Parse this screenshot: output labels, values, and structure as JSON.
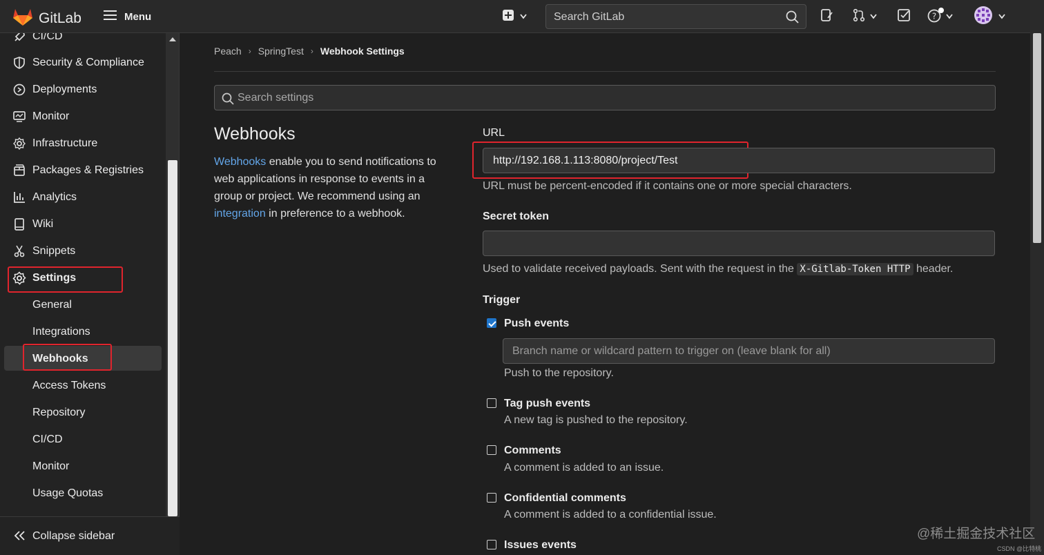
{
  "topbar": {
    "app_name": "GitLab",
    "menu_label": "Menu",
    "search_placeholder": "Search GitLab"
  },
  "sidebar": {
    "items": [
      {
        "label": "CI/CD",
        "icon": "rocket-icon"
      },
      {
        "label": "Security & Compliance",
        "icon": "shield-icon"
      },
      {
        "label": "Deployments",
        "icon": "deployments-icon"
      },
      {
        "label": "Monitor",
        "icon": "monitor-icon"
      },
      {
        "label": "Infrastructure",
        "icon": "cloud-gear-icon"
      },
      {
        "label": "Packages & Registries",
        "icon": "package-icon"
      },
      {
        "label": "Analytics",
        "icon": "chart-icon"
      },
      {
        "label": "Wiki",
        "icon": "book-icon"
      },
      {
        "label": "Snippets",
        "icon": "scissors-icon"
      },
      {
        "label": "Settings",
        "icon": "gear-icon"
      }
    ],
    "sub_items": [
      {
        "label": "General"
      },
      {
        "label": "Integrations"
      },
      {
        "label": "Webhooks"
      },
      {
        "label": "Access Tokens"
      },
      {
        "label": "Repository"
      },
      {
        "label": "CI/CD"
      },
      {
        "label": "Monitor"
      },
      {
        "label": "Usage Quotas"
      }
    ],
    "active_item": "Webhooks",
    "collapse_label": "Collapse sidebar"
  },
  "breadcrumb": {
    "items": [
      "Peach",
      "SpringTest"
    ],
    "current": "Webhook Settings"
  },
  "settings_search": {
    "placeholder": "Search settings"
  },
  "webhooks": {
    "title": "Webhooks",
    "desc_link1": "Webhooks",
    "desc_part1": " enable you to send notifications to web applications in response to events in a group or project. We recommend using an ",
    "desc_link2": "integration",
    "desc_part2": " in preference to a webhook."
  },
  "form": {
    "url_label": "URL",
    "url_value": "http://192.168.1.113:8080/project/Test",
    "url_help": "URL must be percent-encoded if it contains one or more special characters.",
    "secret_label": "Secret token",
    "secret_value": "",
    "secret_help_before": "Used to validate received payloads. Sent with the request in the ",
    "secret_help_code": "X-Gitlab-Token HTTP",
    "secret_help_after": " header.",
    "trigger_label": "Trigger",
    "branch_placeholder": "Branch name or wildcard pattern to trigger on (leave blank for all)",
    "triggers": [
      {
        "label": "Push events",
        "help": "Push to the repository.",
        "checked": true
      },
      {
        "label": "Tag push events",
        "help": "A new tag is pushed to the repository.",
        "checked": false
      },
      {
        "label": "Comments",
        "help": "A comment is added to an issue.",
        "checked": false
      },
      {
        "label": "Confidential comments",
        "help": "A comment is added to a confidential issue.",
        "checked": false
      },
      {
        "label": "Issues events",
        "help": "",
        "checked": false
      }
    ]
  },
  "watermark": {
    "text": "@稀土掘金技术社区",
    "small": "CSDN @比特桃"
  },
  "colors": {
    "accent_link": "#63a6e9",
    "highlight_box": "#e0242d",
    "checkbox": "#1f75cb"
  }
}
